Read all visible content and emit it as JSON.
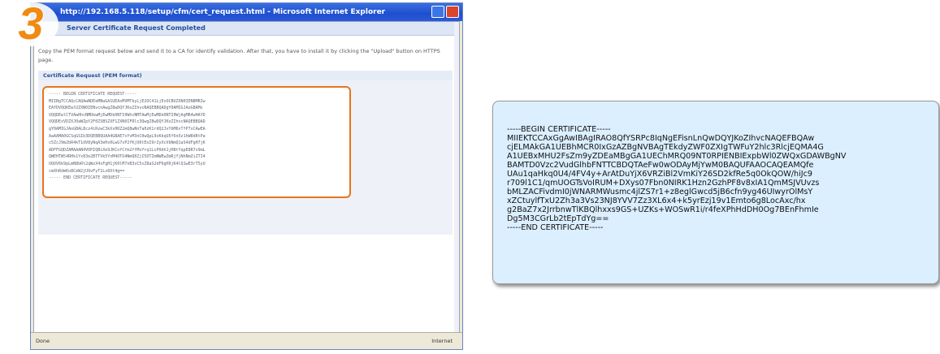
{
  "step": {
    "number": "3",
    "color": "#f08a12"
  },
  "browser": {
    "title": "http://192.168.5.118/setup/cfm/cert_request.html - Microsoft Internet Explorer",
    "page_heading": "Server Certificate Request Completed",
    "instructions": "Copy the PEM format request below and send it to a CA for identify validation. After that, you have to install it by clicking the \"Upload\" button on HTTPS page.",
    "section_label": "Certificate Request (PEM format)",
    "request_lines": [
      "----- BEGIN CERTIFICATE REQUEST-----",
      "MIIBgTCCAQcCAQAwNDEeMBwGA1UEAxMVMTkyLjE2OC41LjExOCBUZXN0IENBMRIw",
      "EAYDVQQKEwlUZXN0IENvcnAwgZ8wDQYJKoZIhvcNAQEBBQADgY0AMIGJAoGBAMx",
      "VQQDEwlCTVAwHhcNMDkwMjEwMDk0NTI0WhcNMTAwMjEwMDk0NTI0WjAgMR4wHAYD",
      "VQQDExVDZXJ0aWZpY2F0ZSBSZXF1ZXN0IFRlc3QwgZ8wDQYJKoZIhvcNAQEBBQAD",
      "gY0AMIGJAoGBAL8cz4iRzwC3kXs0RZ2mQ8wNnTa0zK1rdQ2JvYbM6xTfP7sCAwEA",
      "AaAAMA0GCSqGSIb3DQEBBQUAA4GBAE7xYvM3nC0wQpL9sKkqU5f6nXz1hW8dRtPa",
      "c5ZcJ9m2bR4kT1dV8yNqA3eHs0LwG7xP2fKjU6tEoI9rZyXcVbNmQ1aS4dFgH7jK",
      "ADFFGQDZAMAAAN4VOPIQBiXe9JKCnfCfm2ffMvYrq1LcP0dh1jH8tYqpE8R7x9mL",
      "QWEHTW54RHk1Yx83e2BTTVk5YnM4OTU4NmQ0ZjI5OTZmNWEwZmRjYjNhNmZiZTI4",
      "UQOV6k9pLmN8bRt2qWzX4sFgH1jK0lM7nB3vC5xZ8aS2dF6gH9jK4lQ1wE3rT5yU",
      "cmXhRdmKo8CeW2jU9vFyT1Ls0Xt4g==",
      "----- END CERTIFICATE REQUEST-----"
    ],
    "status_left": "Done",
    "status_right": "Internet"
  },
  "certificate": {
    "lines": [
      "-----BEGIN CERTIFICATE-----",
      "MIIEKTCCAxGgAwIBAgIRAO8QfYSRPc8IqNgEFisnLnQwDQYJKoZIhvcNAQEFBQAw",
      "cjELMAkGA1UEBhMCR0IxGzAZBgNVBAgTEkdyZWF0ZXIgTWFuY2hlc3RlcjEQMA4G",
      "A1UEBxMHU2FsZm9yZDEaMBgGA1UEChMRQ09NT0RPIENBIExpbWl0ZWQxGDAWBgNV",
      "BAMTD0Vzc2VudGlhbFNTTCBDQTAeFw0wODAyMjYwM0BAQUFAAOCAQEAMQfe",
      "UAu1qaHkq0U4/4FV4y+ArAtDuYjX6VRZiBl2VmKiY26SD2kfRe5q0OkQOW/hiJc9",
      "r709l1C1/qmUOGTsVoIRUM+DXys07Fbn0NIRK1Hzn2GzhPF8v8xIA1QmMSJVUvzs",
      "bMLZACFivdmI0jWNARMWusmc4jlZS7r1+z8eglGwcd5jB6cfn9yg46UIwyrOlMsY",
      "xZCtuylfTxU2Zh3a3Vs23NJ8YVV7Zz3XL6x4+k5yrEzj19v1Emto6g8LocAxc/hx",
      "g2BaZ7x2JrrbnwTlKBQlhxxs9GS+UZKs+WOSwR1i/r4fеXPhHdDH0Og7BEnFhmIe",
      "Dg5M3CGrLb2tEpTdYg==",
      "-----END CERTIFICATE-----"
    ]
  }
}
